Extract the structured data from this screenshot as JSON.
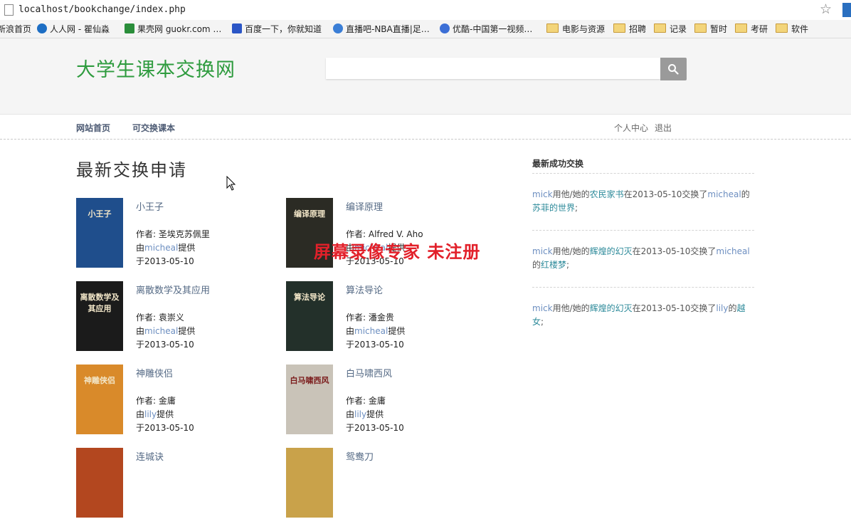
{
  "browser": {
    "url": "localhost/bookchange/index.php",
    "bookmarks": [
      {
        "label": "新浪首页",
        "icon": "sina-icon",
        "color": "#d33"
      },
      {
        "label": "人人网 - 瞿仙淼",
        "icon": "renren-icon",
        "color": "#1d6ec4"
      },
      {
        "label": "果壳网 guokr.com …",
        "icon": "guokr-icon",
        "color": "#2a8d3a"
      },
      {
        "label": "百度一下，你就知道",
        "icon": "baidu-icon",
        "color": "#2b56c6"
      },
      {
        "label": "直播吧-NBA直播|足…",
        "icon": "zhibo8-icon",
        "color": "#3a7ed6"
      },
      {
        "label": "优酷-中国第一视频…",
        "icon": "youku-icon",
        "color": "#3c6fd6"
      },
      {
        "label": "电影与资源",
        "icon": "folder-icon"
      },
      {
        "label": "招聘",
        "icon": "folder-icon"
      },
      {
        "label": "记录",
        "icon": "folder-icon"
      },
      {
        "label": "暂时",
        "icon": "folder-icon"
      },
      {
        "label": "考研",
        "icon": "folder-icon"
      },
      {
        "label": "软件",
        "icon": "folder-icon"
      }
    ]
  },
  "site": {
    "logo": "大学生课本交换网",
    "search_placeholder": "",
    "nav": {
      "home": "网站首页",
      "books": "可交换课本",
      "profile": "个人中心",
      "logout": "退出"
    }
  },
  "main": {
    "title": "最新交换申请",
    "author_prefix": "作者: ",
    "by_prefix": "由",
    "by_suffix": "提供",
    "date_prefix": "于",
    "books": [
      {
        "title": "小王子",
        "author": "圣埃克苏佩里",
        "provider": "micheal",
        "date": "2013-05-10",
        "cover_color": "#1f4e8c",
        "cover_text": "小王子"
      },
      {
        "title": "编译原理",
        "author": "Alfred V. Aho",
        "provider": "micheal",
        "date": "2013-05-10",
        "cover_color": "#2b2b24",
        "cover_text": "编译原理"
      },
      {
        "title": "离散数学及其应用",
        "author": "袁崇义",
        "provider": "micheal",
        "date": "2013-05-10",
        "cover_color": "#1b1b1b",
        "cover_text": "离散数学及其应用"
      },
      {
        "title": "算法导论",
        "author": "潘金贵",
        "provider": "micheal",
        "date": "2013-05-10",
        "cover_color": "#23302a",
        "cover_text": "算法导论"
      },
      {
        "title": "神雕侠侣",
        "author": "金庸",
        "provider": "lily",
        "date": "2013-05-10",
        "cover_color": "#d98a2a",
        "cover_text": "神雕侠侣"
      },
      {
        "title": "白马啸西风",
        "author": "金庸",
        "provider": "lily",
        "date": "2013-05-10",
        "cover_color": "#c9c3b8",
        "cover_text": "白马啸西风"
      },
      {
        "title": "连城诀",
        "author": "",
        "provider": "",
        "date": "",
        "cover_color": "#b3471f",
        "cover_text": ""
      },
      {
        "title": "鸳鸯刀",
        "author": "",
        "provider": "",
        "date": "",
        "cover_color": "#c9a24a",
        "cover_text": ""
      }
    ]
  },
  "sidebar": {
    "title": "最新成功交换",
    "items": [
      {
        "user1": "mick",
        "mid1": "用他/她的",
        "book1": "农民家书",
        "mid2": "在2013-05-10交换了",
        "user2": "micheal",
        "mid3": "的",
        "book2": "苏菲的世界",
        "end": ";"
      },
      {
        "user1": "mick",
        "mid1": "用他/她的",
        "book1": "辉煌的幻灭",
        "mid2": "在2013-05-10交换了",
        "user2": "micheal",
        "mid3": "的",
        "book2": "红楼梦",
        "end": ";"
      },
      {
        "user1": "mick",
        "mid1": "用他/她的",
        "book1": "辉煌的幻灭",
        "mid2": "在2013-05-10交换了",
        "user2": "lily",
        "mid3": "的",
        "book2": "越女",
        "end": ";"
      }
    ]
  },
  "watermark": "屏幕录像专家  未注册"
}
